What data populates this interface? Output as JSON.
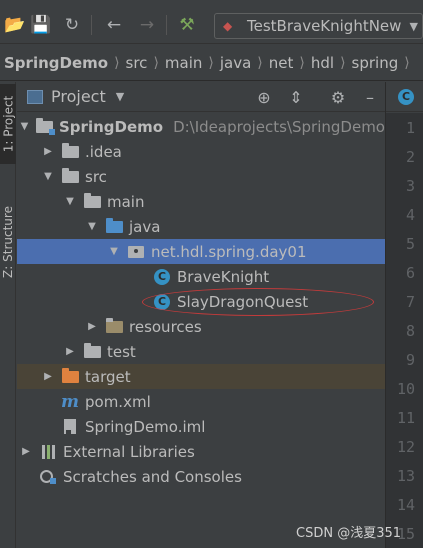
{
  "toolbar": {
    "run_config_label": "TestBraveKnightNew",
    "icons": [
      "open-folder-icon",
      "save-icon",
      "refresh-icon",
      "back-icon",
      "forward-icon",
      "build-hammer-icon"
    ]
  },
  "breadcrumb": [
    "SpringDemo",
    "src",
    "main",
    "java",
    "net",
    "hdl",
    "spring"
  ],
  "tool_stripe": {
    "project_tab": "1: Project",
    "structure_tab": "Z: Structure"
  },
  "project_panel": {
    "title": "Project"
  },
  "tree": [
    {
      "label": "SpringDemo",
      "path": "D:\\Ideaprojects\\SpringDemo"
    },
    {
      "label": ".idea"
    },
    {
      "label": "src"
    },
    {
      "label": "main"
    },
    {
      "label": "java"
    },
    {
      "label": "net.hdl.spring.day01"
    },
    {
      "label": "BraveKnight"
    },
    {
      "label": "SlayDragonQuest"
    },
    {
      "label": "resources"
    },
    {
      "label": "test"
    },
    {
      "label": "target"
    },
    {
      "label": "pom.xml"
    },
    {
      "label": "SpringDemo.iml"
    },
    {
      "label": "External Libraries"
    },
    {
      "label": "Scratches and Consoles"
    }
  ],
  "line_numbers": [
    "1",
    "2",
    "3",
    "4",
    "5",
    "6",
    "7",
    "8",
    "9",
    "10",
    "11",
    "12",
    "13",
    "14",
    "15"
  ],
  "watermark": "CSDN @浅夏351",
  "colors": {
    "background": "#3c3f41",
    "selection": "#4b6eaf",
    "excluded_folder_bg": "#4a4437",
    "annotation_ellipse": "#c23b3b"
  }
}
